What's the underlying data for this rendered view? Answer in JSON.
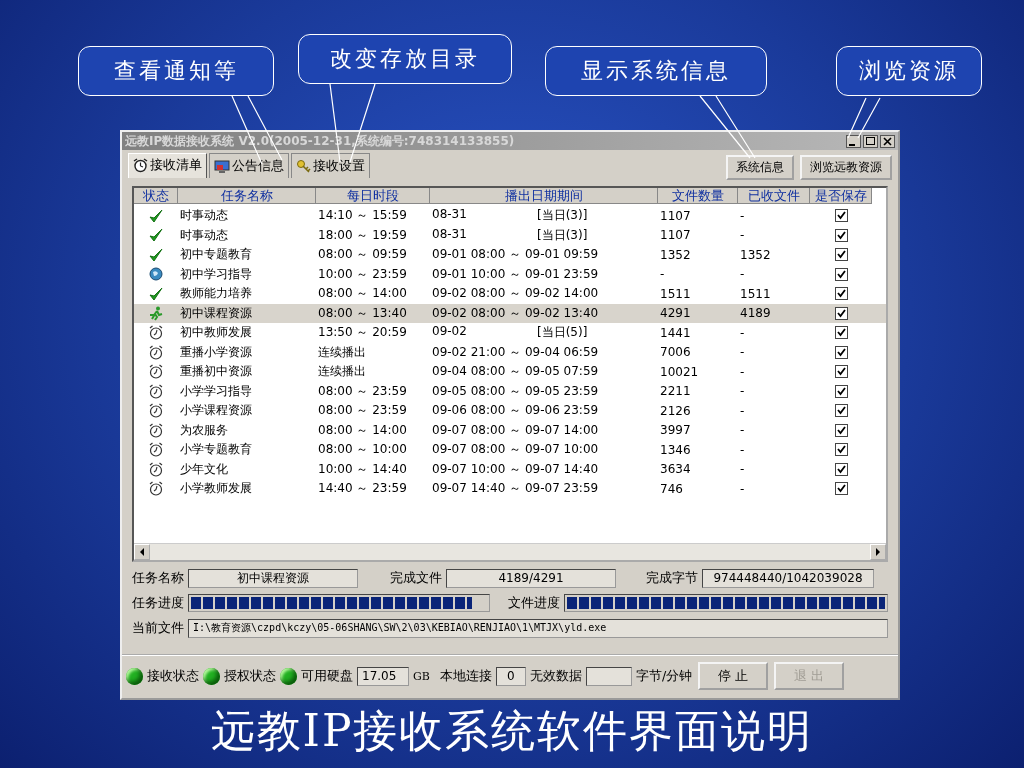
{
  "callouts": [
    {
      "text": "查看通知等"
    },
    {
      "text": "改变存放目录"
    },
    {
      "text": "显示系统信息"
    },
    {
      "text": "浏览资源"
    }
  ],
  "window": {
    "title": "远教IP数据接收系统 V2.0(2005-12-31,系统编号:748314133855)"
  },
  "tabs": [
    {
      "label": "接收清单",
      "selected": true,
      "kind": "clock"
    },
    {
      "label": "公告信息",
      "selected": false,
      "kind": "board"
    },
    {
      "label": "接收设置",
      "selected": false,
      "kind": "key"
    }
  ],
  "toolbar_buttons": [
    "系统信息",
    "浏览远教资源"
  ],
  "table": {
    "columns": [
      "状态",
      "任务名称",
      "每日时段",
      "播出日期期间",
      "文件数量",
      "已收文件",
      "是否保存"
    ],
    "rows": [
      {
        "kind": "done",
        "name": "时事动态",
        "daily": "14:10 ～ 15:59",
        "period": [
          "08-31",
          "[当日(3)]"
        ],
        "files": "1107",
        "received": "-",
        "checked": true,
        "selected": false
      },
      {
        "kind": "done",
        "name": "时事动态",
        "daily": "18:00 ～ 19:59",
        "period": [
          "08-31",
          "[当日(3)]"
        ],
        "files": "1107",
        "received": "-",
        "checked": true,
        "selected": false
      },
      {
        "kind": "done",
        "name": "初中专题教育",
        "daily": "08:00 ～ 09:59",
        "period": [
          "09-01 08:00 ～ 09-01 09:59"
        ],
        "files": "1352",
        "received": "1352",
        "checked": true,
        "selected": false
      },
      {
        "kind": "globe",
        "name": "初中学习指导",
        "daily": "10:00 ～ 23:59",
        "period": [
          "09-01 10:00 ～ 09-01 23:59"
        ],
        "files": "-",
        "received": "-",
        "checked": true,
        "selected": false
      },
      {
        "kind": "done",
        "name": "教师能力培养",
        "daily": "08:00 ～ 14:00",
        "period": [
          "09-02 08:00 ～ 09-02 14:00"
        ],
        "files": "1511",
        "received": "1511",
        "checked": true,
        "selected": false
      },
      {
        "kind": "running",
        "name": "初中课程资源",
        "daily": "08:00 ～ 13:40",
        "period": [
          "09-02 08:00 ～ 09-02 13:40"
        ],
        "files": "4291",
        "received": "4189",
        "checked": true,
        "selected": true
      },
      {
        "kind": "waiting",
        "name": "初中教师发展",
        "daily": "13:50 ～ 20:59",
        "period": [
          "09-02",
          "[当日(5)]"
        ],
        "files": "1441",
        "received": "-",
        "checked": true,
        "selected": false
      },
      {
        "kind": "waiting",
        "name": "重播小学资源",
        "daily": "连续播出",
        "period": [
          "09-02 21:00 ～ 09-04 06:59"
        ],
        "files": "7006",
        "received": "-",
        "checked": true,
        "selected": false
      },
      {
        "kind": "waiting",
        "name": "重播初中资源",
        "daily": "连续播出",
        "period": [
          "09-04 08:00 ～ 09-05 07:59"
        ],
        "files": "10021",
        "received": "-",
        "checked": true,
        "selected": false
      },
      {
        "kind": "waiting",
        "name": "小学学习指导",
        "daily": "08:00 ～ 23:59",
        "period": [
          "09-05 08:00 ～ 09-05 23:59"
        ],
        "files": "2211",
        "received": "-",
        "checked": true,
        "selected": false
      },
      {
        "kind": "waiting",
        "name": "小学课程资源",
        "daily": "08:00 ～ 23:59",
        "period": [
          "09-06 08:00 ～ 09-06 23:59"
        ],
        "files": "2126",
        "received": "-",
        "checked": true,
        "selected": false
      },
      {
        "kind": "waiting",
        "name": "为农服务",
        "daily": "08:00 ～ 14:00",
        "period": [
          "09-07 08:00 ～ 09-07 14:00"
        ],
        "files": "3997",
        "received": "-",
        "checked": true,
        "selected": false
      },
      {
        "kind": "waiting",
        "name": "小学专题教育",
        "daily": "08:00 ～ 10:00",
        "period": [
          "09-07 08:00 ～ 09-07 10:00"
        ],
        "files": "1346",
        "received": "-",
        "checked": true,
        "selected": false
      },
      {
        "kind": "waiting",
        "name": "少年文化",
        "daily": "10:00 ～ 14:40",
        "period": [
          "09-07 10:00 ～ 09-07 14:40"
        ],
        "files": "3634",
        "received": "-",
        "checked": true,
        "selected": false
      },
      {
        "kind": "waiting",
        "name": "小学教师发展",
        "daily": "14:40 ～ 23:59",
        "period": [
          "09-07 14:40 ～ 09-07 23:59"
        ],
        "files": "746",
        "received": "-",
        "checked": true,
        "selected": false
      }
    ]
  },
  "details": {
    "task_label": "任务名称",
    "task_value": "初中课程资源",
    "done_files_label": "完成文件",
    "done_files_value": "4189/4291",
    "done_bytes_label": "完成字节",
    "done_bytes_value": "974448440/1042039028",
    "task_progress_label": "任务进度",
    "task_progress": {
      "level": 0.95
    },
    "file_progress_label": "文件进度",
    "file_progress": {
      "level": 1.0
    },
    "current_file_label": "当前文件",
    "current_file_value": "I:\\教育资源\\czpd\\kczy\\05-06SHANG\\SW\\2\\03\\KEBIAO\\RENJIAO\\1\\MTJX\\yld.exe"
  },
  "status_bar": {
    "lights": [
      {
        "label": "接收状态",
        "on": true
      },
      {
        "label": "授权状态",
        "on": true
      }
    ],
    "disk_label": "可用硬盘",
    "disk_value": "17.05",
    "disk_unit": "GB",
    "local_label": "本地连接",
    "local_value": "0",
    "invalid_label": "无效数据",
    "rate_unit": "字节/分钟",
    "buttons": [
      {
        "label": "停 止",
        "disabled": false
      },
      {
        "label": "退 出",
        "disabled": true
      }
    ]
  },
  "caption": "远教IP接收系统软件界面说明"
}
